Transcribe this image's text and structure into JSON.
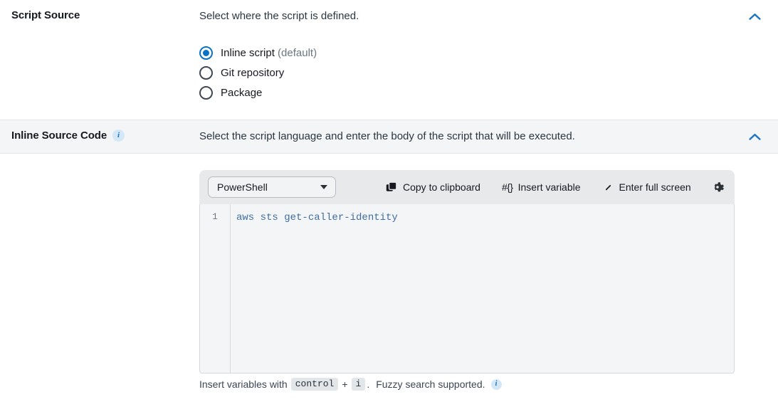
{
  "sections": [
    {
      "title": "Script Source",
      "description": "Select where the script is defined.",
      "collapse_icon": "chevron-up-icon",
      "radios": {
        "options": [
          {
            "label": "Inline script",
            "suffix": "(default)",
            "selected": true
          },
          {
            "label": "Git repository",
            "suffix": "",
            "selected": false
          },
          {
            "label": "Package",
            "suffix": "",
            "selected": false
          }
        ]
      }
    },
    {
      "title": "Inline Source Code",
      "info_icon": "info-icon",
      "info_glyph": "i",
      "description": "Select the script language and enter the body of the script that will be executed.",
      "collapse_icon": "chevron-up-icon"
    }
  ],
  "editor": {
    "language_value": "PowerShell",
    "language_caret_icon": "chevron-down-icon",
    "actions": [
      {
        "label": "Copy to clipboard",
        "icon": "copy-icon"
      },
      {
        "label": "Insert variable",
        "icon": "hash-braces-icon",
        "glyph": "#{}"
      },
      {
        "label": "Enter full screen",
        "icon": "expand-diagonal-icon"
      }
    ],
    "settings_icon": "gear-icon",
    "line_numbers": [
      "1"
    ],
    "code": "aws sts get-caller-identity",
    "footer": {
      "prefix": "Insert variables with",
      "key1": "control",
      "plus": "+",
      "key2": "i",
      "period": ".",
      "suffix": "Fuzzy search supported.",
      "info_icon": "info-icon",
      "info_glyph": "i"
    }
  },
  "colors": {
    "accent": "#0a72c4",
    "band": "#f4f5f7",
    "toolbar": "#e7e9eb",
    "editor_bg": "#f4f5f6",
    "code_text": "#3f6d9e"
  }
}
